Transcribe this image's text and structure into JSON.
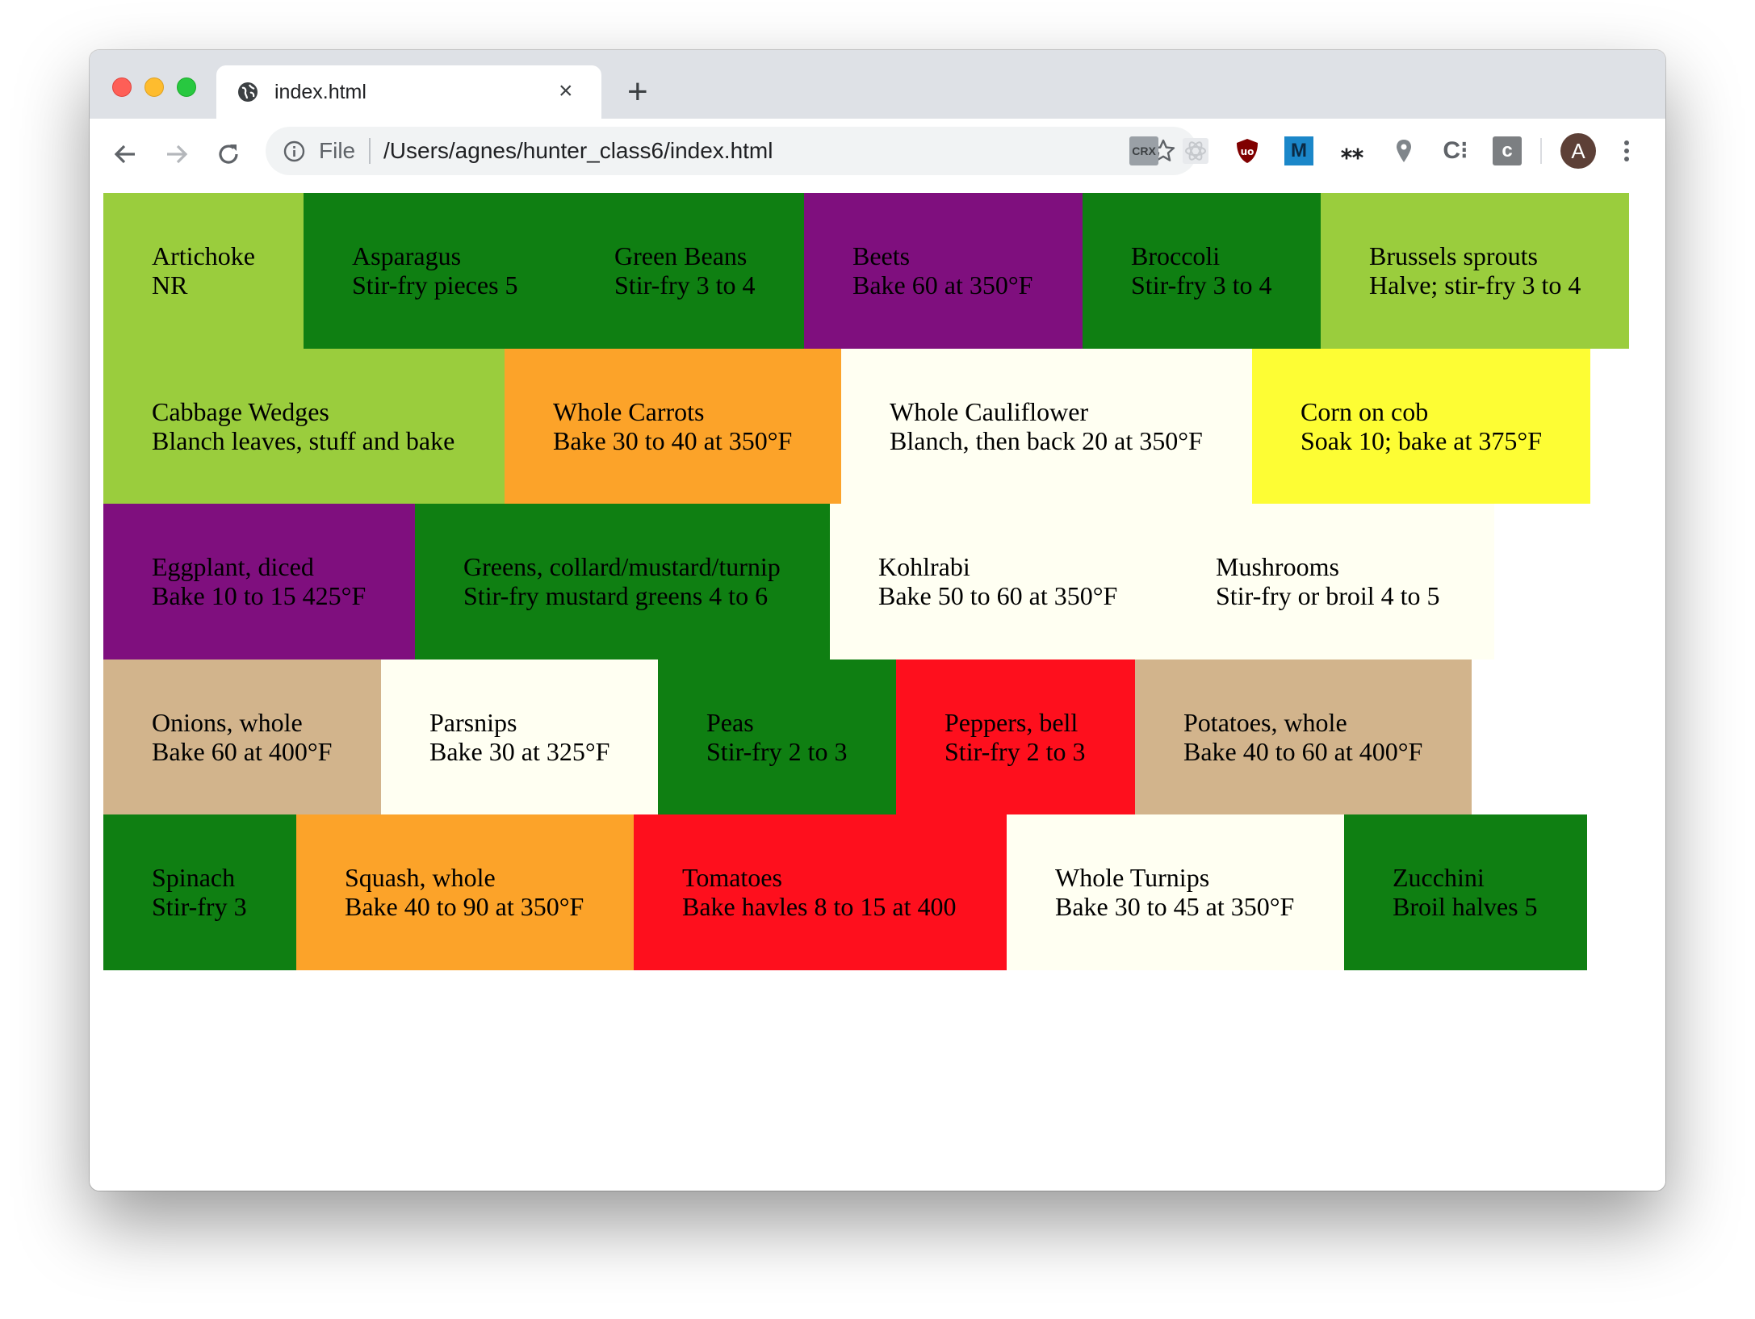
{
  "browser": {
    "tab_title": "index.html",
    "new_tab": "+",
    "close": "×",
    "file_label": "File",
    "url": "/Users/agnes/hunter_class6/index.html",
    "extensions": {
      "crx": "CRX",
      "m": "M",
      "star": "⁎⁎",
      "ci": "C⁝",
      "c": "c"
    },
    "avatar_letter": "A"
  },
  "colors": {
    "yellowgreen": "#9acd3d",
    "green": "#0f7f12",
    "purple": "#7f0f7e",
    "orange": "#fca329",
    "ivory": "#fffff2",
    "yellow": "#fdfd34",
    "tan": "#d2b48c",
    "red": "#fe0f1d"
  },
  "tiles": [
    {
      "name": "Artichoke",
      "note": "NR",
      "color": "#9acd3d",
      "text": "#000000"
    },
    {
      "name": "Asparagus",
      "note": "Stir-fry pieces 5",
      "color": "#0f7f12",
      "text": "#000000"
    },
    {
      "name": "Green Beans",
      "note": "Stir-fry 3 to 4",
      "color": "#0f7f12",
      "text": "#000000"
    },
    {
      "name": "Beets",
      "note": "Bake 60 at 350°F",
      "color": "#7f0f7e",
      "text": "#000000"
    },
    {
      "name": "Broccoli",
      "note": "Stir-fry 3 to 4",
      "color": "#0f7f12",
      "text": "#000000"
    },
    {
      "name": "Brussels sprouts",
      "note": "Halve; stir-fry 3 to 4",
      "color": "#9acd3d",
      "text": "#000000"
    },
    {
      "name": "Cabbage Wedges",
      "note": "Blanch leaves, stuff and bake",
      "color": "#9acd3d",
      "text": "#000000"
    },
    {
      "name": "Whole Carrots",
      "note": "Bake 30 to 40 at 350°F",
      "color": "#fca329",
      "text": "#000000"
    },
    {
      "name": "Whole Cauliflower",
      "note": "Blanch, then back 20 at 350°F",
      "color": "#fffff2",
      "text": "#000000"
    },
    {
      "name": "Corn on cob",
      "note": "Soak 10; bake at 375°F",
      "color": "#fdfd34",
      "text": "#000000"
    },
    {
      "name": "Eggplant, diced",
      "note": "Bake 10 to 15 425°F",
      "color": "#7f0f7e",
      "text": "#000000"
    },
    {
      "name": "Greens, collard/mustard/turnip",
      "note": "Stir-fry mustard greens 4 to 6",
      "color": "#0f7f12",
      "text": "#000000"
    },
    {
      "name": "Kohlrabi",
      "note": "Bake 50 to 60 at 350°F",
      "color": "#fffff2",
      "text": "#000000"
    },
    {
      "name": "Mushrooms",
      "note": "Stir-fry or broil 4 to 5",
      "color": "#fffff2",
      "text": "#000000"
    },
    {
      "name": "Onions, whole",
      "note": "Bake 60 at 400°F",
      "color": "#d2b48c",
      "text": "#000000"
    },
    {
      "name": "Parsnips",
      "note": "Bake 30 at 325°F",
      "color": "#fffff2",
      "text": "#000000"
    },
    {
      "name": "Peas",
      "note": "Stir-fry 2 to 3",
      "color": "#0f7f12",
      "text": "#000000"
    },
    {
      "name": "Peppers, bell",
      "note": "Stir-fry 2 to 3",
      "color": "#fe0f1d",
      "text": "#000000"
    },
    {
      "name": "Potatoes, whole",
      "note": "Bake 40 to 60 at 400°F",
      "color": "#d2b48c",
      "text": "#000000"
    },
    {
      "name": "Spinach",
      "note": "Stir-fry 3",
      "color": "#0f7f12",
      "text": "#000000"
    },
    {
      "name": "Squash, whole",
      "note": "Bake 40 to 90 at 350°F",
      "color": "#fca329",
      "text": "#000000"
    },
    {
      "name": "Tomatoes",
      "note": "Bake havles 8 to 15 at 400",
      "color": "#fe0f1d",
      "text": "#000000"
    },
    {
      "name": "Whole Turnips",
      "note": "Bake 30 to 45 at 350°F",
      "color": "#fffff2",
      "text": "#000000"
    },
    {
      "name": "Zucchini",
      "note": "Broil halves 5",
      "color": "#0f7f12",
      "text": "#000000"
    }
  ]
}
